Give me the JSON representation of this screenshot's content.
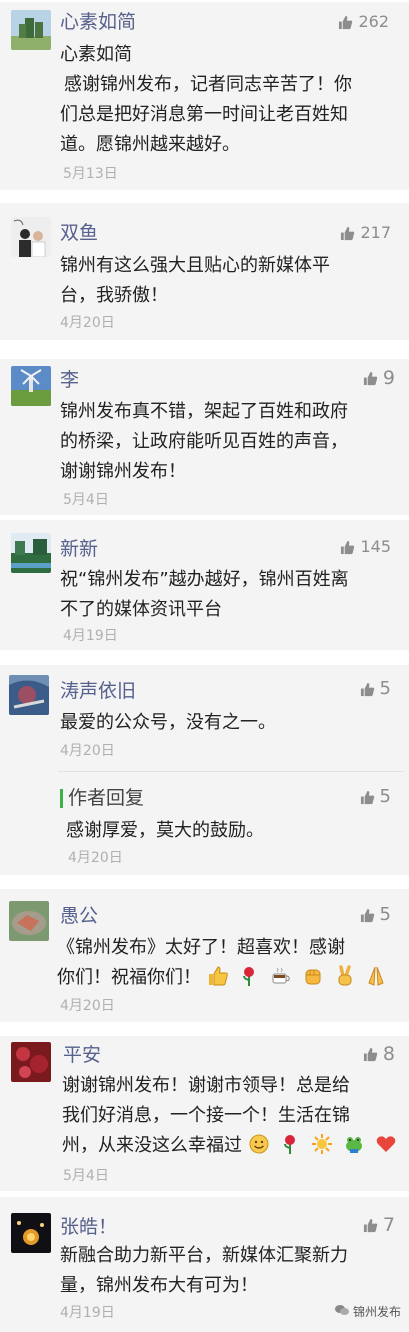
{
  "comments": [
    {
      "name": "心素如简",
      "likes": "262",
      "lines": [
        "心素如简",
        "感谢锦州发布，记者同志辛苦了！你",
        "们总是把好消息第一时间让老百姓知",
        "道。愿锦州越来越好。"
      ],
      "date": "5月13日"
    },
    {
      "name": "双鱼",
      "likes": "217",
      "lines": [
        "锦州有这么强大且贴心的新媒体平",
        "台，我骄傲！"
      ],
      "date": "4月20日"
    },
    {
      "name": "李",
      "likes": "9",
      "lines": [
        "锦州发布真不错，架起了百姓和政府",
        "的桥梁，让政府能听见百姓的声音，",
        "谢谢锦州发布！"
      ],
      "date": "5月4日"
    },
    {
      "name": "新新",
      "likes": "145",
      "lines": [
        "祝“锦州发布”越办越好，锦州百姓离",
        "不了的媒体资讯平台"
      ],
      "date": "4月19日"
    },
    {
      "name": "涛声依旧",
      "likes": "5",
      "lines": [
        "最爱的公众号，没有之一。"
      ],
      "date": "4月20日",
      "reply": {
        "label": "作者回复",
        "likes": "5",
        "text": "感谢厚爱，莫大的鼓励。",
        "date": "4月20日"
      }
    },
    {
      "name": "愚公",
      "likes": "5",
      "lines": [
        "《锦州发布》太好了！超喜欢！感谢",
        "你们！祝福你们！"
      ],
      "date": "4月20日"
    },
    {
      "name": "平安",
      "likes": "8",
      "lines": [
        "谢谢锦州发布！谢谢市领导！总是给",
        "我们好消息，一个接一个！生活在锦",
        "州，从来没这么幸福过"
      ],
      "date": "5月4日"
    },
    {
      "name": "张皓！",
      "likes": "7",
      "lines": [
        "新融合助力新平台，新媒体汇聚新力",
        "量，锦州发布大有可为！"
      ],
      "date": "4月19日"
    }
  ],
  "emojis_row6": [
    "thumbs-up",
    "rose",
    "coffee",
    "fist",
    "victory",
    "pray"
  ],
  "emojis_row7": [
    "smile",
    "rose",
    "sun",
    "frog",
    "heart"
  ],
  "watermark": "锦州发布",
  "colors": {
    "name": "#57618d",
    "text": "#222222",
    "date": "#b0b0b0",
    "card": "#f4f4f4",
    "reply_bar": "#3bb24a"
  }
}
